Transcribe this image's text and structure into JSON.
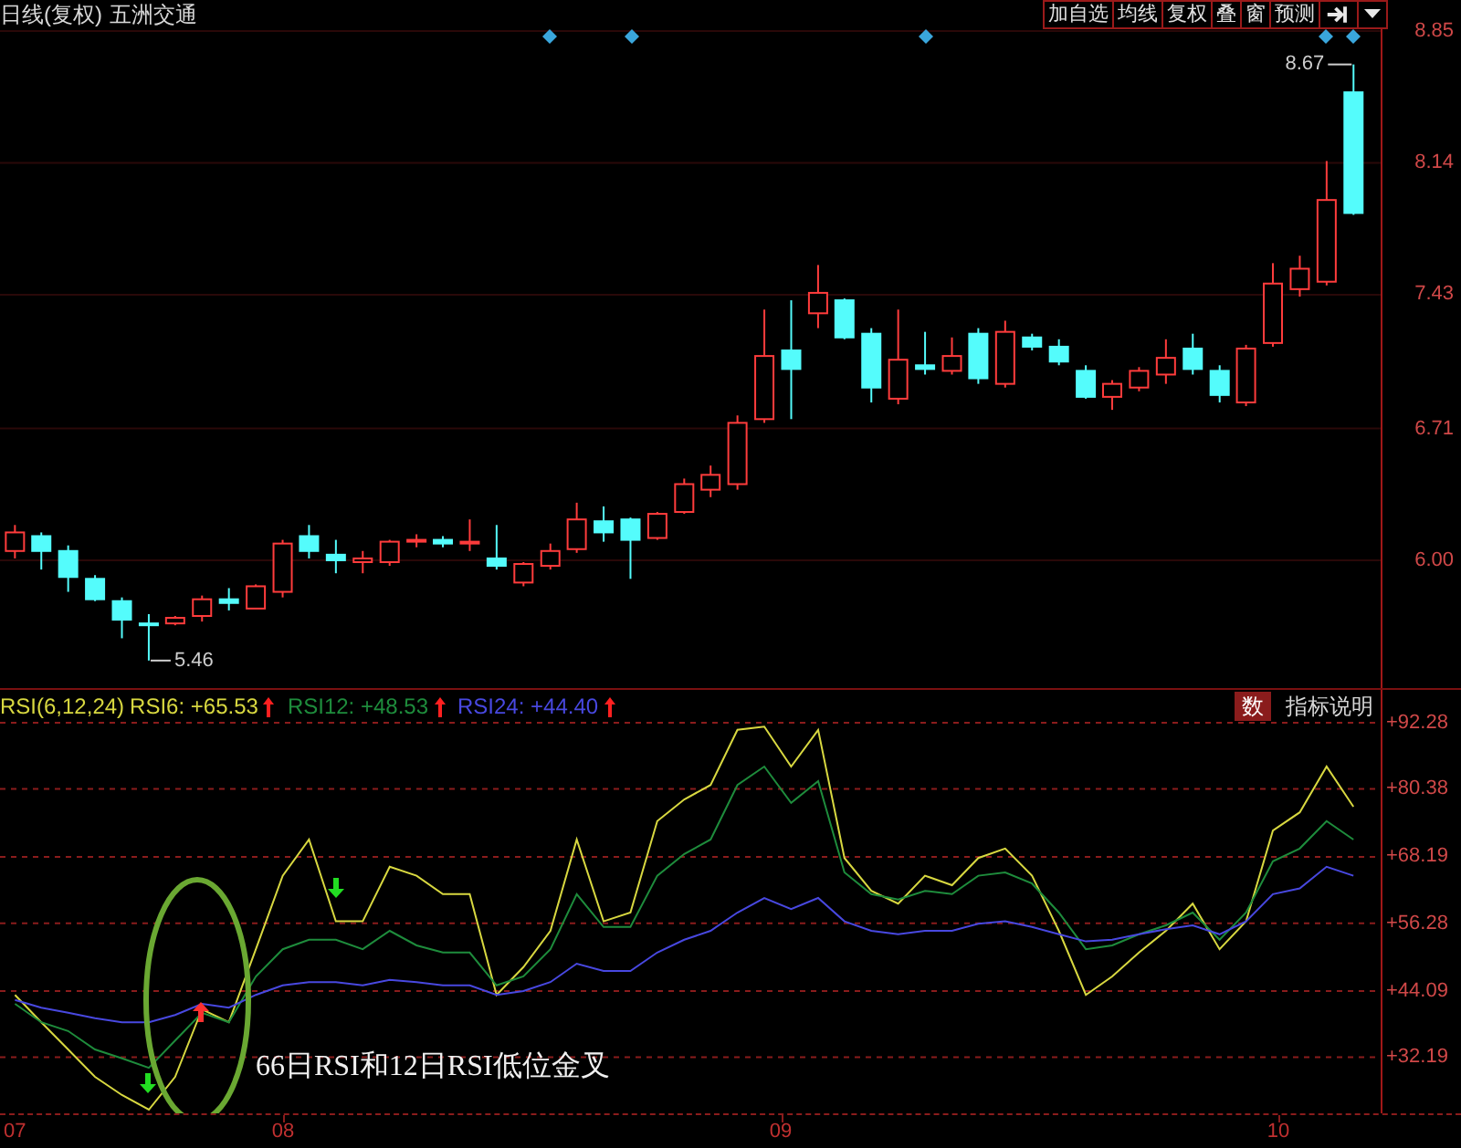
{
  "header": {
    "period": "日线(复权)",
    "stock": "五洲交通"
  },
  "toolbar": [
    {
      "label": "加自选"
    },
    {
      "label": "均线"
    },
    {
      "label": "复权"
    },
    {
      "label": "叠"
    },
    {
      "label": "窗"
    },
    {
      "label": "预测"
    }
  ],
  "price_chart": {
    "chart_data": {
      "type": "candlestick",
      "ylim": [
        5.302,
        9.017
      ],
      "grid": true,
      "yticks": [
        {
          "value": 8.85,
          "label": "8.85"
        },
        {
          "value": 8.14,
          "label": "8.14"
        },
        {
          "value": 7.43,
          "label": "7.43"
        },
        {
          "value": 6.71,
          "label": "6.71"
        },
        {
          "value": 6.0,
          "label": "6.00"
        }
      ],
      "xlim": [
        7.431,
        10.367
      ],
      "x": [
        7.461,
        7.514,
        7.568,
        7.622,
        7.676,
        7.73,
        7.783,
        7.837,
        7.891,
        7.945,
        7.999,
        8.052,
        8.106,
        8.16,
        8.214,
        8.268,
        8.321,
        8.375,
        8.429,
        8.483,
        8.537,
        8.59,
        8.644,
        8.698,
        8.752,
        8.806,
        8.859,
        8.913,
        8.967,
        9.021,
        9.075,
        9.128,
        9.182,
        9.236,
        9.29,
        9.344,
        9.397,
        9.451,
        9.505,
        9.559,
        9.613,
        9.666,
        9.72,
        9.774,
        9.828,
        9.882,
        9.935,
        9.989,
        10.043,
        10.097,
        10.151
      ],
      "ohlc": [
        [
          6.05,
          6.19,
          6.01,
          6.15
        ],
        [
          6.13,
          6.15,
          5.95,
          6.05
        ],
        [
          6.05,
          6.08,
          5.83,
          5.91
        ],
        [
          5.9,
          5.92,
          5.78,
          5.79
        ],
        [
          5.78,
          5.8,
          5.58,
          5.68
        ],
        [
          5.66,
          5.71,
          5.46,
          5.65
        ],
        [
          5.66,
          5.7,
          5.65,
          5.69
        ],
        [
          5.7,
          5.81,
          5.67,
          5.79
        ],
        [
          5.79,
          5.85,
          5.73,
          5.77
        ],
        [
          5.74,
          5.87,
          5.74,
          5.86
        ],
        [
          5.83,
          6.11,
          5.8,
          6.09
        ],
        [
          6.13,
          6.19,
          6.01,
          6.05
        ],
        [
          6.03,
          6.11,
          5.93,
          6.0
        ],
        [
          5.99,
          6.05,
          5.93,
          6.01
        ],
        [
          5.99,
          6.11,
          5.97,
          6.1
        ],
        [
          6.1,
          6.14,
          6.07,
          6.11
        ],
        [
          6.11,
          6.13,
          6.07,
          6.09
        ],
        [
          6.09,
          6.22,
          6.05,
          6.1
        ],
        [
          6.01,
          6.19,
          5.95,
          5.97
        ],
        [
          5.88,
          5.99,
          5.86,
          5.98
        ],
        [
          5.97,
          6.09,
          5.95,
          6.05
        ],
        [
          6.06,
          6.31,
          6.04,
          6.22
        ],
        [
          6.21,
          6.29,
          6.1,
          6.15
        ],
        [
          6.22,
          6.23,
          5.9,
          6.11
        ],
        [
          6.12,
          6.26,
          6.11,
          6.25
        ],
        [
          6.26,
          6.44,
          6.25,
          6.41
        ],
        [
          6.38,
          6.51,
          6.34,
          6.46
        ],
        [
          6.41,
          6.78,
          6.38,
          6.74
        ],
        [
          6.76,
          7.35,
          6.74,
          7.1
        ],
        [
          7.13,
          7.4,
          6.76,
          7.03
        ],
        [
          7.33,
          7.59,
          7.25,
          7.44
        ],
        [
          7.4,
          7.41,
          7.19,
          7.2
        ],
        [
          7.22,
          7.25,
          6.85,
          6.93
        ],
        [
          6.87,
          7.35,
          6.84,
          7.08
        ],
        [
          7.05,
          7.23,
          7.0,
          7.03
        ],
        [
          7.02,
          7.2,
          7.0,
          7.1
        ],
        [
          7.22,
          7.25,
          6.95,
          6.98
        ],
        [
          6.95,
          7.29,
          6.93,
          7.23
        ],
        [
          7.2,
          7.22,
          7.13,
          7.15
        ],
        [
          7.15,
          7.19,
          7.05,
          7.07
        ],
        [
          7.02,
          7.05,
          6.87,
          6.88
        ],
        [
          6.88,
          6.97,
          6.81,
          6.95
        ],
        [
          6.93,
          7.04,
          6.91,
          7.02
        ],
        [
          7.0,
          7.19,
          6.95,
          7.09
        ],
        [
          7.14,
          7.22,
          7.0,
          7.03
        ],
        [
          7.02,
          7.05,
          6.85,
          6.89
        ],
        [
          6.85,
          7.16,
          6.83,
          7.14
        ],
        [
          7.17,
          7.6,
          7.15,
          7.49
        ],
        [
          7.46,
          7.64,
          7.42,
          7.57
        ],
        [
          7.5,
          8.15,
          7.48,
          7.94
        ],
        [
          8.52,
          8.67,
          7.86,
          7.87
        ]
      ]
    },
    "price_marks": [
      {
        "kind": "high",
        "label": "8.67"
      },
      {
        "kind": "low",
        "label": "5.46"
      }
    ]
  },
  "indicator": {
    "name": "RSI(6,12,24)",
    "readings": [
      {
        "label": "RSI6: +65.53",
        "color": "#d8d840"
      },
      {
        "label": "RSI12: +48.53",
        "color": "#1e8c3c"
      },
      {
        "label": "RSI24: +44.40",
        "color": "#4848e0"
      }
    ],
    "axis_start_label": "07",
    "buttons": [
      {
        "label": "数",
        "selected": true
      },
      {
        "label": "指标说明",
        "selected": false
      }
    ],
    "chart_data": {
      "type": "line",
      "ylim": [
        22.13,
        98.18
      ],
      "grid": true,
      "xlim": [
        7.431,
        10.367
      ],
      "x": [
        7.461,
        7.514,
        7.568,
        7.622,
        7.676,
        7.73,
        7.783,
        7.837,
        7.891,
        7.945,
        7.999,
        8.052,
        8.106,
        8.16,
        8.214,
        8.268,
        8.321,
        8.375,
        8.429,
        8.483,
        8.537,
        8.59,
        8.644,
        8.698,
        8.752,
        8.806,
        8.859,
        8.913,
        8.967,
        9.021,
        9.075,
        9.128,
        9.182,
        9.236,
        9.29,
        9.344,
        9.397,
        9.451,
        9.505,
        9.559,
        9.613,
        9.666,
        9.72,
        9.774,
        9.828,
        9.882,
        9.935,
        9.989,
        10.043,
        10.097,
        10.151
      ],
      "xticks": [
        {
          "value": 8,
          "label": "08"
        },
        {
          "value": 9,
          "label": "09"
        },
        {
          "value": 10,
          "label": "10"
        }
      ],
      "yticks": [
        {
          "value": 92.28,
          "label": "+92.28"
        },
        {
          "value": 80.38,
          "label": "+80.38"
        },
        {
          "value": 68.19,
          "label": "+68.19"
        },
        {
          "value": 56.28,
          "label": "+56.28"
        },
        {
          "value": 44.09,
          "label": "+44.09"
        },
        {
          "value": 32.19,
          "label": "+32.19"
        }
      ],
      "series": [
        {
          "color": "#d8d840",
          "values": [
            43.4,
            38.5,
            33.6,
            28.7,
            25.4,
            22.8,
            28.7,
            40.8,
            38.5,
            51.6,
            64.8,
            71.3,
            56.6,
            56.6,
            66.4,
            64.8,
            61.5,
            61.5,
            43.4,
            48.4,
            54.9,
            71.3,
            56.6,
            58.2,
            74.6,
            78.5,
            81.1,
            91.0,
            91.6,
            84.4,
            91.0,
            68.0,
            62.1,
            59.8,
            64.8,
            63.1,
            68.0,
            69.7,
            64.8,
            54.9,
            43.4,
            46.7,
            51.0,
            54.9,
            59.8,
            51.6,
            56.6,
            72.9,
            76.2,
            84.4,
            77.2
          ]
        },
        {
          "color": "#1e8c3c",
          "values": [
            41.8,
            38.5,
            36.9,
            33.6,
            32.0,
            30.3,
            35.2,
            40.2,
            38.5,
            46.7,
            51.6,
            53.3,
            53.3,
            51.6,
            54.9,
            52.3,
            51.0,
            51.0,
            45.1,
            46.7,
            51.6,
            61.5,
            55.6,
            55.6,
            64.8,
            68.7,
            71.3,
            81.1,
            84.4,
            77.9,
            81.8,
            65.4,
            61.5,
            60.5,
            62.1,
            61.5,
            64.8,
            65.4,
            63.4,
            58.2,
            51.6,
            52.3,
            54.3,
            55.9,
            58.2,
            53.3,
            58.2,
            67.4,
            69.7,
            74.6,
            71.3
          ]
        },
        {
          "color": "#4848e0",
          "values": [
            42.5,
            41.1,
            40.2,
            39.2,
            38.5,
            38.5,
            39.8,
            41.8,
            41.1,
            43.4,
            45.1,
            45.7,
            45.7,
            45.1,
            46.1,
            45.7,
            45.1,
            45.1,
            43.4,
            44.1,
            45.7,
            49.0,
            47.7,
            47.7,
            51.0,
            53.3,
            54.9,
            58.2,
            60.8,
            58.8,
            60.8,
            56.6,
            54.9,
            54.3,
            54.9,
            54.9,
            56.2,
            56.6,
            55.6,
            54.3,
            53.0,
            53.3,
            54.3,
            55.2,
            55.9,
            54.3,
            56.6,
            61.5,
            62.5,
            66.4,
            64.8
          ]
        }
      ]
    }
  },
  "annotation": "66日RSI和12日RSI低位金叉"
}
